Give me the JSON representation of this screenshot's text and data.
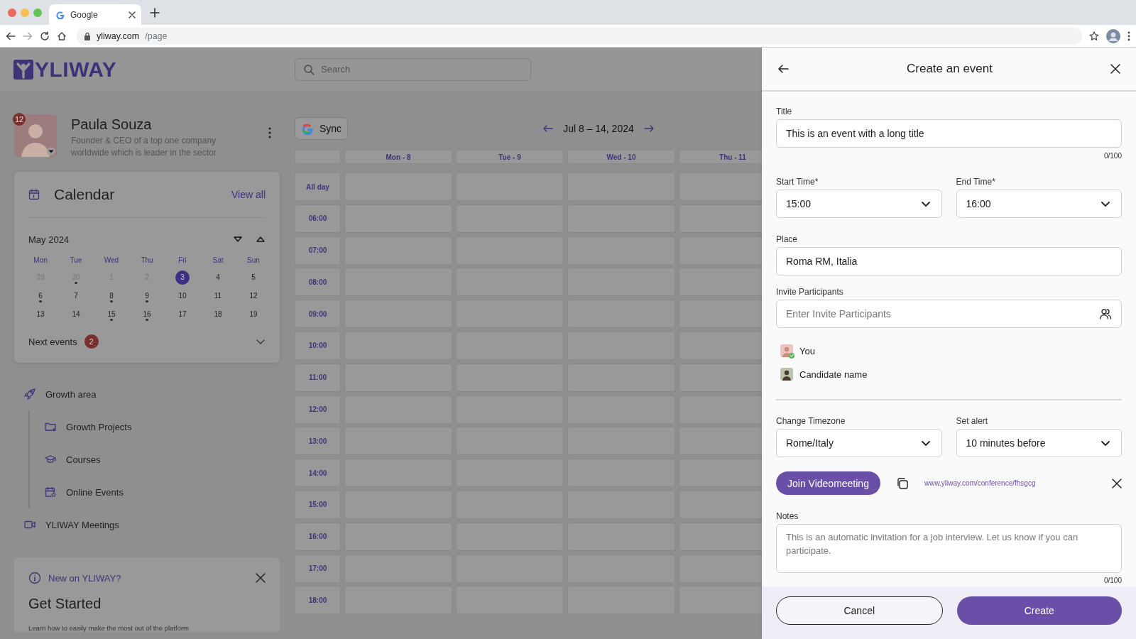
{
  "browser": {
    "tab_title": "Google",
    "url_host": "yliway.com",
    "url_path": "/page"
  },
  "header": {
    "logo": "YLIWAY",
    "search": {
      "placeholder": "Search"
    }
  },
  "profile": {
    "name": "Paula Souza",
    "notifications": "12",
    "subtitle": "Founder & CEO of a top one company worldwide which is leader in the sector"
  },
  "calendar_card": {
    "title": "Calendar",
    "view_all": "View all",
    "month": "May 2024",
    "weekdays": [
      "Mon",
      "Tue",
      "Wed",
      "Thu",
      "Fri",
      "Sat",
      "Sun"
    ],
    "weeks": [
      [
        {
          "label": "29",
          "muted": true,
          "selected": false,
          "event": false
        },
        {
          "label": "30",
          "muted": true,
          "selected": false,
          "event": true
        },
        {
          "label": "1",
          "muted": true,
          "selected": false,
          "event": false
        },
        {
          "label": "2",
          "muted": true,
          "selected": false,
          "event": false
        },
        {
          "label": "3",
          "muted": false,
          "selected": true,
          "event": false
        },
        {
          "label": "4",
          "muted": false,
          "selected": false,
          "event": false
        },
        {
          "label": "5",
          "muted": false,
          "selected": false,
          "event": false
        }
      ],
      [
        {
          "label": "6",
          "muted": false,
          "selected": false,
          "event": true
        },
        {
          "label": "7",
          "muted": false,
          "selected": false,
          "event": false
        },
        {
          "label": "8",
          "muted": false,
          "selected": false,
          "event": true
        },
        {
          "label": "9",
          "muted": false,
          "selected": false,
          "event": true
        },
        {
          "label": "10",
          "muted": false,
          "selected": false,
          "event": false
        },
        {
          "label": "11",
          "muted": false,
          "selected": false,
          "event": false
        },
        {
          "label": "12",
          "muted": false,
          "selected": false,
          "event": false
        }
      ],
      [
        {
          "label": "13",
          "muted": false,
          "selected": false,
          "event": false
        },
        {
          "label": "14",
          "muted": false,
          "selected": false,
          "event": false
        },
        {
          "label": "15",
          "muted": false,
          "selected": false,
          "event": true
        },
        {
          "label": "16",
          "muted": false,
          "selected": false,
          "event": true
        },
        {
          "label": "17",
          "muted": false,
          "selected": false,
          "event": false
        },
        {
          "label": "18",
          "muted": false,
          "selected": false,
          "event": false
        },
        {
          "label": "19",
          "muted": false,
          "selected": false,
          "event": false
        }
      ]
    ],
    "next_events": {
      "label": "Next events",
      "count": "2",
      "expanded": false
    }
  },
  "nav": [
    {
      "label": "Growth area",
      "kind": "rocket",
      "children": [
        {
          "label": "Growth Projects",
          "kind": "folder"
        },
        {
          "label": "Courses",
          "kind": "cap"
        },
        {
          "label": "Online Events",
          "kind": "calendar-star"
        }
      ]
    },
    {
      "label": "YLIWAY Meetings",
      "kind": "video"
    }
  ],
  "get_started": {
    "kicker": "New on YLIWAY?",
    "title": "Get Started",
    "text": "Learn how to easily make the most out of the platform"
  },
  "week_view": {
    "sync": "Sync",
    "range": "Jul 8 – 14, 2024",
    "days": [
      "Mon - 8",
      "Tue - 9",
      "Wed - 10",
      "Thu - 11"
    ],
    "rows": [
      "All day",
      "06:00",
      "07:00",
      "08:00",
      "09:00",
      "10:00",
      "11:00",
      "12:00",
      "13:00",
      "14:00",
      "15:00",
      "16:00",
      "17:00",
      "18:00"
    ]
  },
  "event_panel": {
    "title": "Create an event",
    "title_field": {
      "label": "Title",
      "value": "This is an event with a long title",
      "counter": "0/100"
    },
    "start_time": {
      "label": "Start Time*",
      "value": "15:00"
    },
    "end_time": {
      "label": "End Time*",
      "value": "16:00"
    },
    "place": {
      "label": "Place",
      "value": "Roma RM, Italia"
    },
    "participants": {
      "label": "Invite Participants",
      "placeholder": "Enter Invite Participants",
      "people": [
        {
          "name": "You",
          "confirmed": true
        },
        {
          "name": "Candidate name",
          "confirmed": false
        }
      ]
    },
    "timezone": {
      "label": "Change Timezone",
      "value": "Rome/Italy"
    },
    "alert": {
      "label": "Set alert",
      "value": "10 minutes before"
    },
    "video": {
      "button": "Join Videomeeting",
      "link": "www.yliway.com/conference/fhsgcg"
    },
    "notes": {
      "label": "Notes",
      "placeholder": "This is an automatic invitation for a job interview. Let us know if you can participate.",
      "counter": "0/100"
    },
    "buttons": {
      "cancel": "Cancel",
      "create": "Create"
    }
  }
}
